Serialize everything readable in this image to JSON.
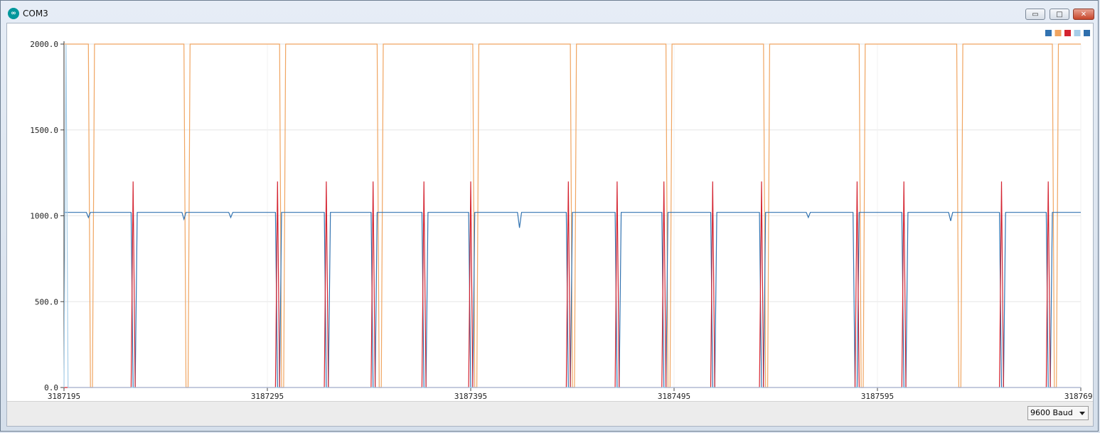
{
  "window": {
    "title": "COM3",
    "controls": {
      "minimize": "▭",
      "maximize": "□",
      "close": "✕"
    },
    "app_icon": "arduino-infinity-icon"
  },
  "footer": {
    "baud_selected": "9600 Baud"
  },
  "legend_colors": [
    "#3273b1",
    "#f0a561",
    "#d42330",
    "#a6cde8",
    "#2f6fad"
  ],
  "chart_data": {
    "type": "line",
    "title": "",
    "xlabel": "",
    "ylabel": "",
    "ylim": [
      0,
      2000
    ],
    "xlim": [
      3187195,
      3187695
    ],
    "yticks": [
      "0.0",
      "500.0",
      "1000.0",
      "1500.0",
      "2000.0"
    ],
    "xticks": [
      "3187195",
      "3187295",
      "3187395",
      "3187495",
      "3187595",
      "3187695"
    ],
    "grid": true,
    "legend_position": "top-right",
    "series": [
      {
        "color": "#f0a561",
        "points": [
          [
            3187195,
            2000
          ],
          [
            3187207,
            2000
          ],
          [
            3187208,
            0
          ],
          [
            3187209,
            0
          ],
          [
            3187210,
            2000
          ],
          [
            3187254,
            2000
          ],
          [
            3187255,
            0
          ],
          [
            3187256,
            0
          ],
          [
            3187257,
            2000
          ],
          [
            3187301,
            2000
          ],
          [
            3187302,
            0
          ],
          [
            3187303,
            0
          ],
          [
            3187304,
            2000
          ],
          [
            3187349,
            2000
          ],
          [
            3187350,
            0
          ],
          [
            3187351,
            0
          ],
          [
            3187352,
            2000
          ],
          [
            3187396,
            2000
          ],
          [
            3187397,
            0
          ],
          [
            3187398,
            0
          ],
          [
            3187399,
            2000
          ],
          [
            3187444,
            2000
          ],
          [
            3187445,
            0
          ],
          [
            3187446,
            0
          ],
          [
            3187447,
            2000
          ],
          [
            3187491,
            2000
          ],
          [
            3187492,
            0
          ],
          [
            3187493,
            0
          ],
          [
            3187494,
            2000
          ],
          [
            3187539,
            2000
          ],
          [
            3187540,
            0
          ],
          [
            3187541,
            0
          ],
          [
            3187542,
            2000
          ],
          [
            3187586,
            2000
          ],
          [
            3187587,
            0
          ],
          [
            3187588,
            0
          ],
          [
            3187589,
            2000
          ],
          [
            3187634,
            2000
          ],
          [
            3187635,
            0
          ],
          [
            3187636,
            0
          ],
          [
            3187637,
            2000
          ],
          [
            3187681,
            2000
          ],
          [
            3187682,
            0
          ],
          [
            3187683,
            0
          ],
          [
            3187684,
            2000
          ],
          [
            3187695,
            2000
          ]
        ]
      },
      {
        "color": "#3273b1",
        "points": [
          [
            3187195,
            1020
          ],
          [
            3187206,
            1020
          ],
          [
            3187207,
            990
          ],
          [
            3187208,
            1020
          ],
          [
            3187228,
            1020
          ],
          [
            3187229,
            0
          ],
          [
            3187230,
            0
          ],
          [
            3187231,
            1020
          ],
          [
            3187253,
            1020
          ],
          [
            3187254,
            980
          ],
          [
            3187255,
            1020
          ],
          [
            3187276,
            1020
          ],
          [
            3187277,
            990
          ],
          [
            3187278,
            1020
          ],
          [
            3187299,
            1020
          ],
          [
            3187300,
            0
          ],
          [
            3187301,
            0
          ],
          [
            3187302,
            1020
          ],
          [
            3187323,
            1020
          ],
          [
            3187324,
            0
          ],
          [
            3187325,
            0
          ],
          [
            3187326,
            1020
          ],
          [
            3187346,
            1020
          ],
          [
            3187347,
            0
          ],
          [
            3187348,
            0
          ],
          [
            3187349,
            1020
          ],
          [
            3187371,
            1020
          ],
          [
            3187372,
            0
          ],
          [
            3187373,
            0
          ],
          [
            3187374,
            1020
          ],
          [
            3187394,
            1020
          ],
          [
            3187395,
            0
          ],
          [
            3187396,
            0
          ],
          [
            3187397,
            1020
          ],
          [
            3187418,
            1020
          ],
          [
            3187419,
            930
          ],
          [
            3187420,
            1020
          ],
          [
            3187442,
            1020
          ],
          [
            3187443,
            0
          ],
          [
            3187444,
            0
          ],
          [
            3187445,
            1020
          ],
          [
            3187466,
            1020
          ],
          [
            3187467,
            0
          ],
          [
            3187468,
            0
          ],
          [
            3187469,
            1020
          ],
          [
            3187489,
            1020
          ],
          [
            3187490,
            0
          ],
          [
            3187491,
            0
          ],
          [
            3187492,
            1020
          ],
          [
            3187513,
            1020
          ],
          [
            3187514,
            0
          ],
          [
            3187515,
            0
          ],
          [
            3187516,
            1020
          ],
          [
            3187537,
            1020
          ],
          [
            3187538,
            0
          ],
          [
            3187539,
            0
          ],
          [
            3187540,
            1020
          ],
          [
            3187560,
            1020
          ],
          [
            3187561,
            990
          ],
          [
            3187562,
            1020
          ],
          [
            3187583,
            1020
          ],
          [
            3187584,
            0
          ],
          [
            3187585,
            0
          ],
          [
            3187586,
            1020
          ],
          [
            3187607,
            1020
          ],
          [
            3187608,
            0
          ],
          [
            3187609,
            0
          ],
          [
            3187610,
            1020
          ],
          [
            3187630,
            1020
          ],
          [
            3187631,
            970
          ],
          [
            3187632,
            1020
          ],
          [
            3187655,
            1020
          ],
          [
            3187656,
            0
          ],
          [
            3187657,
            0
          ],
          [
            3187658,
            1020
          ],
          [
            3187678,
            1020
          ],
          [
            3187679,
            0
          ],
          [
            3187680,
            0
          ],
          [
            3187681,
            1020
          ],
          [
            3187695,
            1020
          ]
        ]
      },
      {
        "color": "#d42330",
        "points": [
          [
            3187195,
            0
          ],
          [
            3187228,
            0
          ],
          [
            3187229,
            1200
          ],
          [
            3187230,
            0
          ],
          [
            3187299,
            0
          ],
          [
            3187300,
            1200
          ],
          [
            3187301,
            0
          ],
          [
            3187323,
            0
          ],
          [
            3187324,
            1200
          ],
          [
            3187325,
            0
          ],
          [
            3187346,
            0
          ],
          [
            3187347,
            1200
          ],
          [
            3187348,
            0
          ],
          [
            3187371,
            0
          ],
          [
            3187372,
            1200
          ],
          [
            3187373,
            0
          ],
          [
            3187394,
            0
          ],
          [
            3187395,
            1200
          ],
          [
            3187396,
            0
          ],
          [
            3187442,
            0
          ],
          [
            3187443,
            1200
          ],
          [
            3187444,
            0
          ],
          [
            3187466,
            0
          ],
          [
            3187467,
            1200
          ],
          [
            3187468,
            0
          ],
          [
            3187489,
            0
          ],
          [
            3187490,
            1200
          ],
          [
            3187491,
            0
          ],
          [
            3187513,
            0
          ],
          [
            3187514,
            1200
          ],
          [
            3187515,
            0
          ],
          [
            3187537,
            0
          ],
          [
            3187538,
            1200
          ],
          [
            3187539,
            0
          ],
          [
            3187584,
            0
          ],
          [
            3187585,
            1200
          ],
          [
            3187586,
            0
          ],
          [
            3187607,
            0
          ],
          [
            3187608,
            1200
          ],
          [
            3187609,
            0
          ],
          [
            3187655,
            0
          ],
          [
            3187656,
            1200
          ],
          [
            3187657,
            0
          ],
          [
            3187678,
            0
          ],
          [
            3187679,
            1200
          ],
          [
            3187680,
            0
          ],
          [
            3187695,
            0
          ]
        ]
      },
      {
        "color": "#a6cde8",
        "points": [
          [
            3187195,
            0
          ],
          [
            3187196,
            2000
          ],
          [
            3187197,
            0
          ],
          [
            3187695,
            0
          ]
        ]
      }
    ]
  }
}
